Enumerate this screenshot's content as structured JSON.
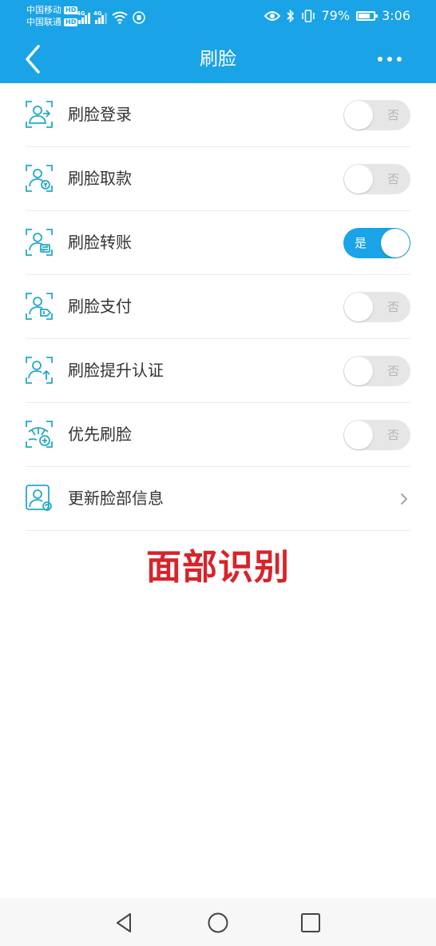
{
  "status_bar": {
    "carrier1": "中国移动",
    "carrier2": "中国联通",
    "hd_badge": "HD",
    "net1": "4G",
    "net2": "4G",
    "battery_percent": "79%",
    "battery_level": 0.79,
    "time": "3:06",
    "icons": [
      "eye-icon",
      "bluetooth-icon",
      "vibrate-icon",
      "wifi-icon",
      "battery-icon"
    ]
  },
  "header": {
    "title": "刷脸",
    "back_icon": "chevron-left-icon",
    "more_icon": "more-dots-icon",
    "color": "#1aa3e6"
  },
  "settings": {
    "items": [
      {
        "label": "刷脸登录",
        "icon": "face-login-icon",
        "state": "否",
        "enabled": false
      },
      {
        "label": "刷脸取款",
        "icon": "face-withdraw-icon",
        "state": "否",
        "enabled": false
      },
      {
        "label": "刷脸转账",
        "icon": "face-transfer-icon",
        "state": "是",
        "enabled": true
      },
      {
        "label": "刷脸支付",
        "icon": "face-pay-icon",
        "state": "否",
        "enabled": false
      },
      {
        "label": "刷脸提升认证",
        "icon": "face-upgrade-icon",
        "state": "否",
        "enabled": false
      },
      {
        "label": "优先刷脸",
        "icon": "face-priority-icon",
        "state": "否",
        "enabled": false
      }
    ],
    "update_item": {
      "label": "更新脸部信息",
      "icon": "face-update-icon",
      "trailing_icon": "chevron-right-icon"
    }
  },
  "overlay": {
    "caption": "面部识别",
    "color": "#d8232a"
  },
  "nav_bar": {
    "icons": [
      "back-triangle-icon",
      "home-circle-icon",
      "recents-square-icon"
    ]
  }
}
